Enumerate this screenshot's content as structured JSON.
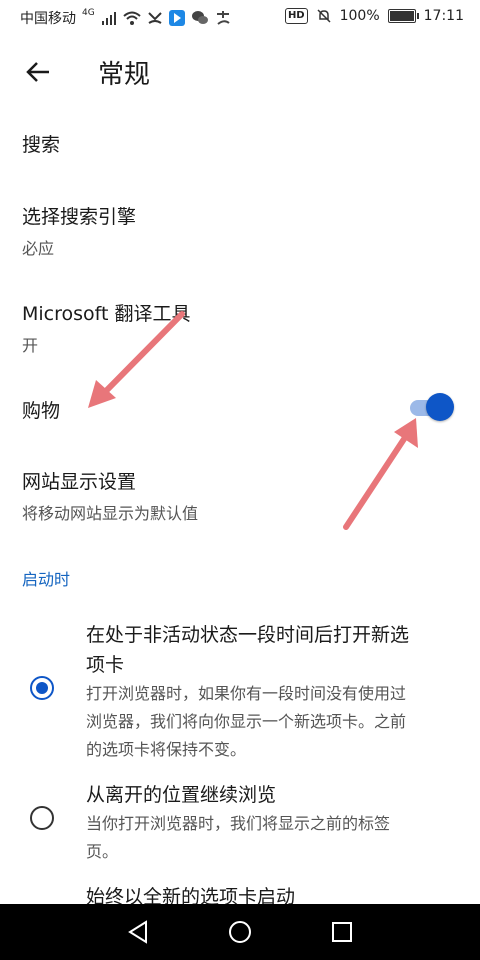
{
  "status_bar": {
    "carrier": "中国移动",
    "network": "4G",
    "battery": "100%",
    "battery_level": 1.0,
    "time": "17:11",
    "hd": "HD"
  },
  "app_bar": {
    "title": "常规"
  },
  "settings": [
    {
      "title": "搜索",
      "subtitle": ""
    },
    {
      "title": "选择搜索引擎",
      "subtitle": "必应"
    },
    {
      "title": "Microsoft 翻译工具",
      "subtitle": "开"
    },
    {
      "title": "购物",
      "subtitle": "",
      "toggle_on": true
    },
    {
      "title": "网站显示设置",
      "subtitle": "将移动网站显示为默认值"
    }
  ],
  "section_header": "启动时",
  "startup_options": [
    {
      "title_line1": "在处于非活动状态一段时间后打开新选",
      "title_line2": "项卡",
      "desc_line1": "打开浏览器时，如果你有一段时间没有使用过",
      "desc_line2": "浏览器，我们将向你显示一个新选项卡。之前",
      "desc_line3": "的选项卡将保持不变。",
      "checked": true
    },
    {
      "title_line1": "从离开的位置继续浏览",
      "desc_line1": "当你打开浏览器时，我们将显示之前的标签",
      "desc_line2": "页。",
      "checked": false
    },
    {
      "title_line1": "始终以全新的选项卡启动",
      "checked": false
    }
  ],
  "colors": {
    "accent": "#0e56c7",
    "section": "#1565c0",
    "annotation_arrow": "#e8767a"
  },
  "icons": [
    "back-arrow-icon",
    "wifi-icon",
    "signal-icon",
    "mute-icon",
    "battery-icon",
    "nav-back-icon",
    "nav-home-icon",
    "nav-recents-icon"
  ]
}
